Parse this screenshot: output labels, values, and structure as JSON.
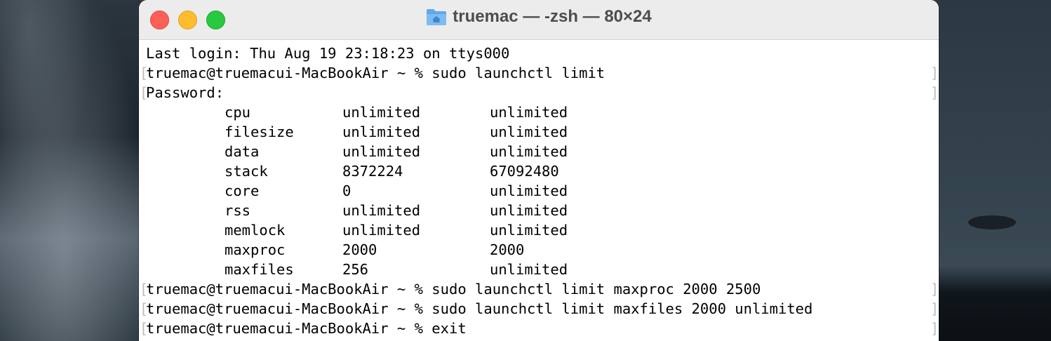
{
  "window": {
    "title": "truemac — -zsh — 80×24",
    "folder_icon": "folder-home-icon"
  },
  "terminal": {
    "last_login": "Last login: Thu Aug 19 23:18:23 on ttys000",
    "prompt": "truemac@truemacui-MacBookAir ~ % ",
    "cmd1": "sudo launchctl limit",
    "password_prompt": "Password:",
    "limits": [
      {
        "name": "cpu",
        "soft": "unlimited",
        "hard": "unlimited"
      },
      {
        "name": "filesize",
        "soft": "unlimited",
        "hard": "unlimited"
      },
      {
        "name": "data",
        "soft": "unlimited",
        "hard": "unlimited"
      },
      {
        "name": "stack",
        "soft": "8372224",
        "hard": "67092480"
      },
      {
        "name": "core",
        "soft": "0",
        "hard": "unlimited"
      },
      {
        "name": "rss",
        "soft": "unlimited",
        "hard": "unlimited"
      },
      {
        "name": "memlock",
        "soft": "unlimited",
        "hard": "unlimited"
      },
      {
        "name": "maxproc",
        "soft": "2000",
        "hard": "2000"
      },
      {
        "name": "maxfiles",
        "soft": "256",
        "hard": "unlimited"
      }
    ],
    "cmd2": "sudo launchctl limit maxproc 2000 2500",
    "cmd3": "sudo launchctl limit maxfiles 2000 unlimited",
    "cmd4": "exit",
    "mark_left": "[",
    "mark_right": "]"
  },
  "colors": {
    "close": "#fe5f57",
    "minimize": "#febc2e",
    "maximize": "#28c840"
  }
}
